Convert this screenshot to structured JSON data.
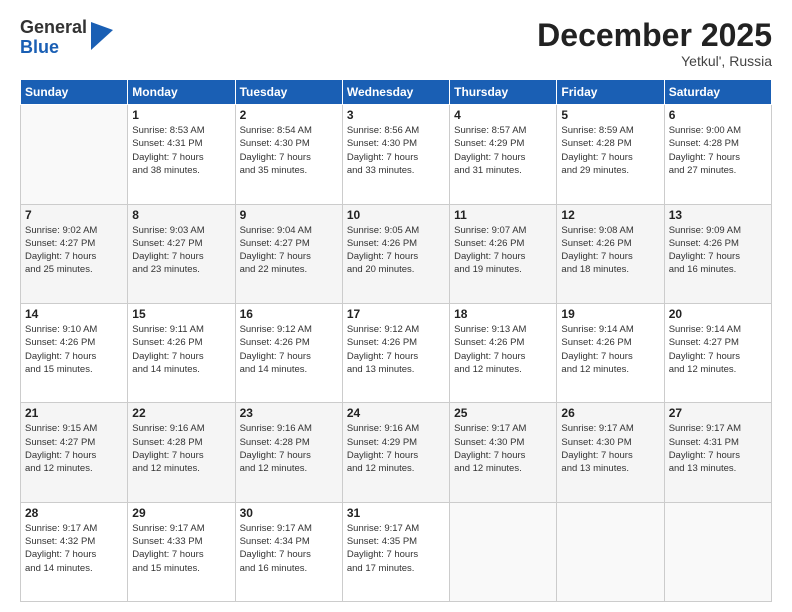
{
  "logo": {
    "general": "General",
    "blue": "Blue"
  },
  "header": {
    "month": "December 2025",
    "location": "Yetkul', Russia"
  },
  "weekdays": [
    "Sunday",
    "Monday",
    "Tuesday",
    "Wednesday",
    "Thursday",
    "Friday",
    "Saturday"
  ],
  "weeks": [
    [
      {
        "day": "",
        "info": ""
      },
      {
        "day": "1",
        "info": "Sunrise: 8:53 AM\nSunset: 4:31 PM\nDaylight: 7 hours\nand 38 minutes."
      },
      {
        "day": "2",
        "info": "Sunrise: 8:54 AM\nSunset: 4:30 PM\nDaylight: 7 hours\nand 35 minutes."
      },
      {
        "day": "3",
        "info": "Sunrise: 8:56 AM\nSunset: 4:30 PM\nDaylight: 7 hours\nand 33 minutes."
      },
      {
        "day": "4",
        "info": "Sunrise: 8:57 AM\nSunset: 4:29 PM\nDaylight: 7 hours\nand 31 minutes."
      },
      {
        "day": "5",
        "info": "Sunrise: 8:59 AM\nSunset: 4:28 PM\nDaylight: 7 hours\nand 29 minutes."
      },
      {
        "day": "6",
        "info": "Sunrise: 9:00 AM\nSunset: 4:28 PM\nDaylight: 7 hours\nand 27 minutes."
      }
    ],
    [
      {
        "day": "7",
        "info": "Sunrise: 9:02 AM\nSunset: 4:27 PM\nDaylight: 7 hours\nand 25 minutes."
      },
      {
        "day": "8",
        "info": "Sunrise: 9:03 AM\nSunset: 4:27 PM\nDaylight: 7 hours\nand 23 minutes."
      },
      {
        "day": "9",
        "info": "Sunrise: 9:04 AM\nSunset: 4:27 PM\nDaylight: 7 hours\nand 22 minutes."
      },
      {
        "day": "10",
        "info": "Sunrise: 9:05 AM\nSunset: 4:26 PM\nDaylight: 7 hours\nand 20 minutes."
      },
      {
        "day": "11",
        "info": "Sunrise: 9:07 AM\nSunset: 4:26 PM\nDaylight: 7 hours\nand 19 minutes."
      },
      {
        "day": "12",
        "info": "Sunrise: 9:08 AM\nSunset: 4:26 PM\nDaylight: 7 hours\nand 18 minutes."
      },
      {
        "day": "13",
        "info": "Sunrise: 9:09 AM\nSunset: 4:26 PM\nDaylight: 7 hours\nand 16 minutes."
      }
    ],
    [
      {
        "day": "14",
        "info": "Sunrise: 9:10 AM\nSunset: 4:26 PM\nDaylight: 7 hours\nand 15 minutes."
      },
      {
        "day": "15",
        "info": "Sunrise: 9:11 AM\nSunset: 4:26 PM\nDaylight: 7 hours\nand 14 minutes."
      },
      {
        "day": "16",
        "info": "Sunrise: 9:12 AM\nSunset: 4:26 PM\nDaylight: 7 hours\nand 14 minutes."
      },
      {
        "day": "17",
        "info": "Sunrise: 9:12 AM\nSunset: 4:26 PM\nDaylight: 7 hours\nand 13 minutes."
      },
      {
        "day": "18",
        "info": "Sunrise: 9:13 AM\nSunset: 4:26 PM\nDaylight: 7 hours\nand 12 minutes."
      },
      {
        "day": "19",
        "info": "Sunrise: 9:14 AM\nSunset: 4:26 PM\nDaylight: 7 hours\nand 12 minutes."
      },
      {
        "day": "20",
        "info": "Sunrise: 9:14 AM\nSunset: 4:27 PM\nDaylight: 7 hours\nand 12 minutes."
      }
    ],
    [
      {
        "day": "21",
        "info": "Sunrise: 9:15 AM\nSunset: 4:27 PM\nDaylight: 7 hours\nand 12 minutes."
      },
      {
        "day": "22",
        "info": "Sunrise: 9:16 AM\nSunset: 4:28 PM\nDaylight: 7 hours\nand 12 minutes."
      },
      {
        "day": "23",
        "info": "Sunrise: 9:16 AM\nSunset: 4:28 PM\nDaylight: 7 hours\nand 12 minutes."
      },
      {
        "day": "24",
        "info": "Sunrise: 9:16 AM\nSunset: 4:29 PM\nDaylight: 7 hours\nand 12 minutes."
      },
      {
        "day": "25",
        "info": "Sunrise: 9:17 AM\nSunset: 4:30 PM\nDaylight: 7 hours\nand 12 minutes."
      },
      {
        "day": "26",
        "info": "Sunrise: 9:17 AM\nSunset: 4:30 PM\nDaylight: 7 hours\nand 13 minutes."
      },
      {
        "day": "27",
        "info": "Sunrise: 9:17 AM\nSunset: 4:31 PM\nDaylight: 7 hours\nand 13 minutes."
      }
    ],
    [
      {
        "day": "28",
        "info": "Sunrise: 9:17 AM\nSunset: 4:32 PM\nDaylight: 7 hours\nand 14 minutes."
      },
      {
        "day": "29",
        "info": "Sunrise: 9:17 AM\nSunset: 4:33 PM\nDaylight: 7 hours\nand 15 minutes."
      },
      {
        "day": "30",
        "info": "Sunrise: 9:17 AM\nSunset: 4:34 PM\nDaylight: 7 hours\nand 16 minutes."
      },
      {
        "day": "31",
        "info": "Sunrise: 9:17 AM\nSunset: 4:35 PM\nDaylight: 7 hours\nand 17 minutes."
      },
      {
        "day": "",
        "info": ""
      },
      {
        "day": "",
        "info": ""
      },
      {
        "day": "",
        "info": ""
      }
    ]
  ]
}
